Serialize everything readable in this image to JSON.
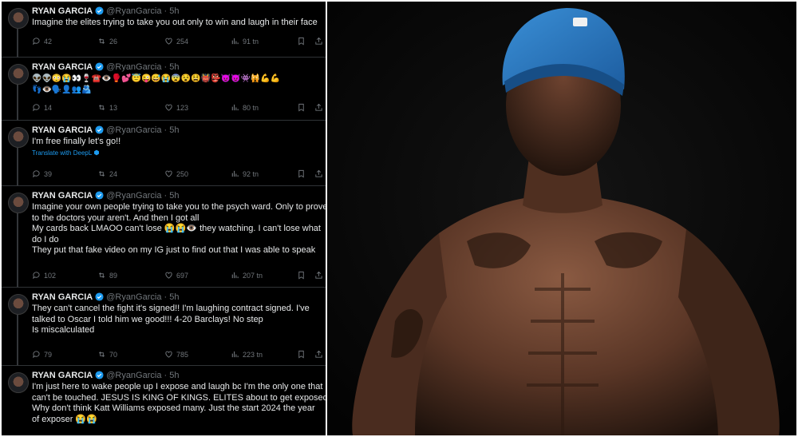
{
  "author": {
    "name": "RYAN GARCIA",
    "handle": "@RyanGarcia",
    "dot": "·"
  },
  "tweets": [
    {
      "time": "5h",
      "lines": [
        "Imagine the elites trying to take you out only to win and laugh in their face"
      ],
      "replies": "42",
      "reposts": "26",
      "likes": "254",
      "views": "91 tn"
    },
    {
      "time": "5h",
      "lines": [
        "👽👽😳😭👀🍷☎️👁️🥊💕😇😜😅😭😨😵😫👹👺😈😈👾🙀💪💪",
        "👣👁️🗣️👤👥🫂"
      ],
      "replies": "14",
      "reposts": "13",
      "likes": "123",
      "views": "80 tn"
    },
    {
      "time": "5h",
      "lines": [
        "I'm free finally let's go!!"
      ],
      "translate": "Translate with DeepL",
      "replies": "39",
      "reposts": "24",
      "likes": "250",
      "views": "92 tn"
    },
    {
      "time": "5h",
      "lines": [
        "Imagine your own people trying to take you to the psych ward. Only to prove",
        "to the doctors your aren't. And then I got all",
        "My cards back LMAOO can't lose 😭😭👁️ they watching. I can't lose what",
        "do I do",
        "They put that fake video on my IG just to find out that I was able to speak"
      ],
      "replies": "102",
      "reposts": "89",
      "likes": "697",
      "views": "207 tn"
    },
    {
      "time": "5h",
      "lines": [
        "They can't cancel the fight it's signed!! I'm laughing contract signed. I've",
        "talked to Oscar I told him we good!!! 4-20 Barclays! No step",
        "Is miscalculated"
      ],
      "replies": "79",
      "reposts": "70",
      "likes": "785",
      "views": "223 tn"
    },
    {
      "time": "5h",
      "lines": [
        "I'm just here to wake people up I expose and laugh bc I'm the only one that",
        "can't be touched. JESUS IS KING OF KINGS. ELITES about to get exposed.",
        "Why don't think Katt Williams exposed many. Just the start 2024 the year",
        "of exposer 😭😭"
      ]
    }
  ],
  "colors": {
    "background": "#000000",
    "text": "#e7e9ea",
    "muted": "#71767b",
    "accent": "#1d9bf0",
    "divider": "#2f3336"
  }
}
